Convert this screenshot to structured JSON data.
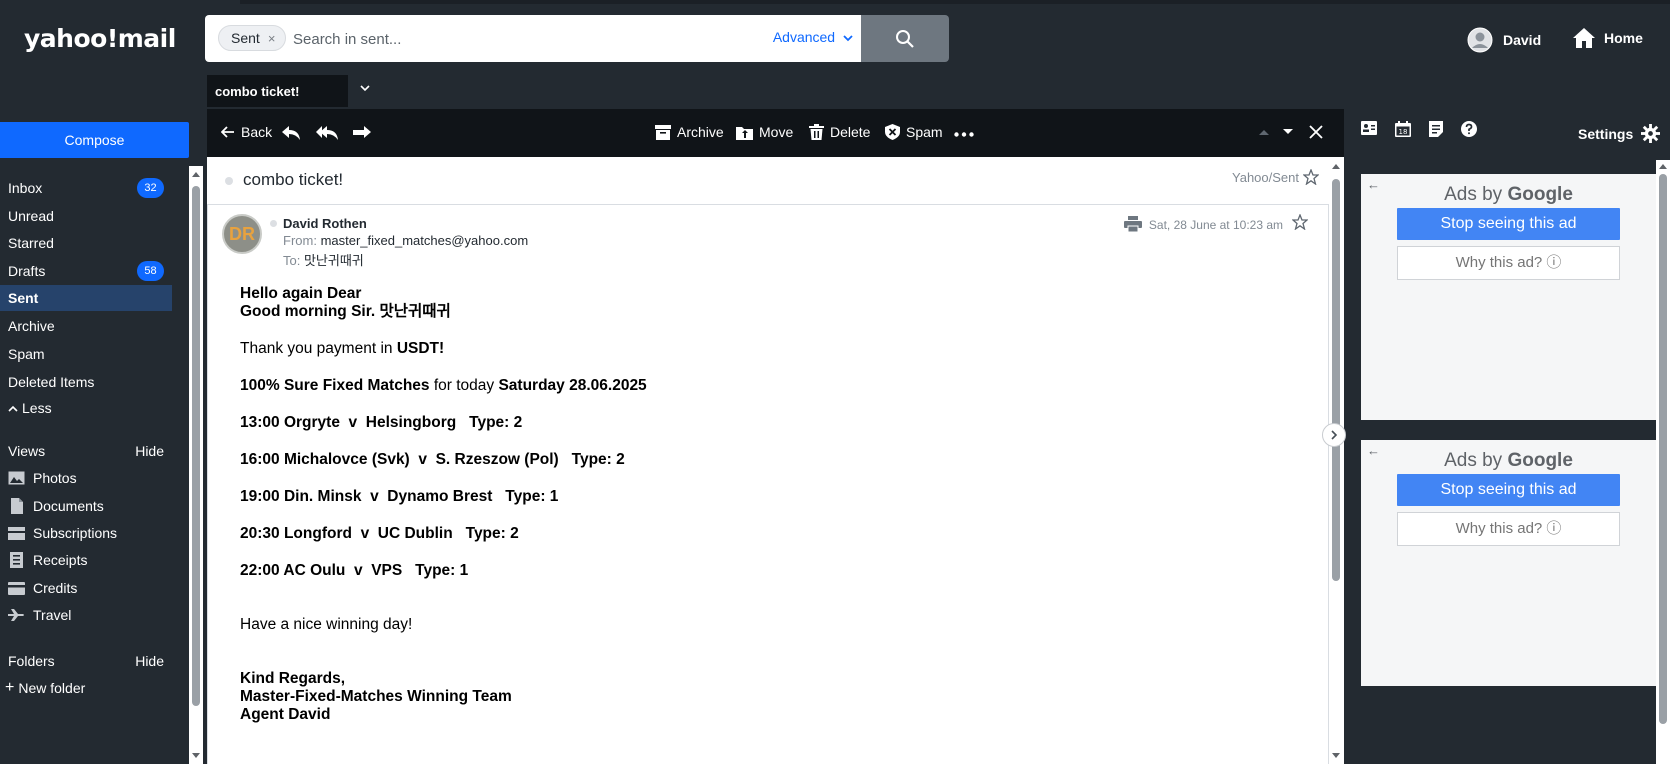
{
  "app": {
    "logo": "yahoo!mail"
  },
  "search": {
    "chip_label": "Sent",
    "chip_close": "×",
    "placeholder": "Search in sent...",
    "advanced_label": "Advanced"
  },
  "header": {
    "user_name": "David",
    "home_label": "Home"
  },
  "tabs": [
    {
      "label": "combo ticket!"
    }
  ],
  "sidebar": {
    "compose_label": "Compose",
    "items": [
      {
        "label": "Inbox",
        "count": "32"
      },
      {
        "label": "Unread"
      },
      {
        "label": "Starred"
      },
      {
        "label": "Drafts",
        "count": "58"
      },
      {
        "label": "Sent"
      },
      {
        "label": "Archive"
      },
      {
        "label": "Spam"
      },
      {
        "label": "Deleted Items"
      }
    ],
    "less_label": "Less",
    "views_label": "Views",
    "views_hide": "Hide",
    "views": [
      {
        "label": "Photos",
        "icon": "photo-icon"
      },
      {
        "label": "Documents",
        "icon": "document-icon"
      },
      {
        "label": "Subscriptions",
        "icon": "subscriptions-icon"
      },
      {
        "label": "Receipts",
        "icon": "receipt-icon"
      },
      {
        "label": "Credits",
        "icon": "credit-card-icon"
      },
      {
        "label": "Travel",
        "icon": "plane-icon"
      }
    ],
    "folders_label": "Folders",
    "folders_hide": "Hide",
    "new_folder_label": "New folder"
  },
  "toolbar": {
    "back": "Back",
    "archive": "Archive",
    "move": "Move",
    "delete": "Delete",
    "spam": "Spam"
  },
  "message": {
    "subject": "combo ticket!",
    "folder": "Yahoo/Sent",
    "avatar_initials": "DR",
    "sender_name": "David Rothen",
    "from_label": "From:",
    "from_address": "master_fixed_matches@yahoo.com",
    "to_label": "To:",
    "to_value": "맛난귀때귀",
    "date": "Sat, 28 June at 10:23 am",
    "body": {
      "greeting1": "Hello again Dear",
      "greeting2": "Good morning Sir. 맛난귀때귀",
      "thanks_prefix": "Thank you payment in ",
      "thanks_bold": "USDT!",
      "headline_bold1": "100% Sure Fixed Matches",
      "headline_mid": " for today ",
      "headline_bold2": "Saturday 28.06.2025",
      "matches": [
        "13:00 Orgryte  v  Helsingborg   Type: 2",
        "16:00 Michalovce (Svk)  v  S. Rzeszow (Pol)   Type: 2",
        "19:00 Din. Minsk  v  Dynamo Brest   Type: 1",
        "20:30 Longford  v  UC Dublin   Type: 2",
        "22:00 AC Oulu  v  VPS   Type: 1"
      ],
      "closing": "Have a nice winning day!",
      "signoff1": "Kind Regards,",
      "signoff2": "Master-Fixed-Matches Winning Team",
      "signoff3": "Agent David"
    }
  },
  "rail": {
    "settings_label": "Settings"
  },
  "ads": [
    {
      "ads_by": "Ads by ",
      "brand": "Google",
      "stop": "Stop seeing this ad",
      "why": "Why this ad? ⓘ"
    },
    {
      "ads_by": "Ads by ",
      "brand": "Google",
      "stop": "Stop seeing this ad",
      "why": "Why this ad? ⓘ"
    }
  ],
  "colors": {
    "accent": "#0f69ff",
    "background": "#232a31",
    "toolbar": "#101418",
    "active_nav": "#26436b",
    "ad_button": "#4285f4"
  }
}
